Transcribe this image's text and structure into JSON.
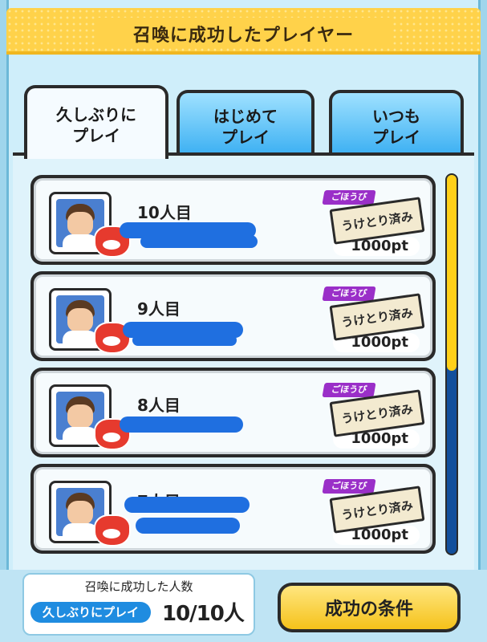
{
  "header": {
    "title": "召喚に成功したプレイヤー"
  },
  "tabs": [
    {
      "label": "久しぶりに\nプレイ",
      "active": true
    },
    {
      "label": "はじめて\nプレイ",
      "active": false
    },
    {
      "label": "いつも\nプレイ",
      "active": false
    }
  ],
  "rows": [
    {
      "count_label": "10人目",
      "reward_tag": "ごほうび",
      "stamp": "うけとり済み",
      "points": "1000pt"
    },
    {
      "count_label": "9人目",
      "reward_tag": "ごほうび",
      "stamp": "うけとり済み",
      "points": "1000pt"
    },
    {
      "count_label": "8人目",
      "reward_tag": "ごほうび",
      "stamp": "うけとり済み",
      "points": "1000pt"
    },
    {
      "count_label": "7人目",
      "reward_tag": "ごほうび",
      "stamp": "うけとり済み",
      "points": "1000pt"
    }
  ],
  "footer": {
    "count_title": "召喚に成功した人数",
    "pill_label": "久しぶりにプレイ",
    "count_value": "10/10人",
    "condition_button": "成功の条件"
  },
  "colors": {
    "header": "#ffd24a",
    "tab": "#38aef2",
    "scroll_thumb": "#ffd019",
    "scroll_track": "#124f9c",
    "redaction": "#1f6fe0"
  }
}
